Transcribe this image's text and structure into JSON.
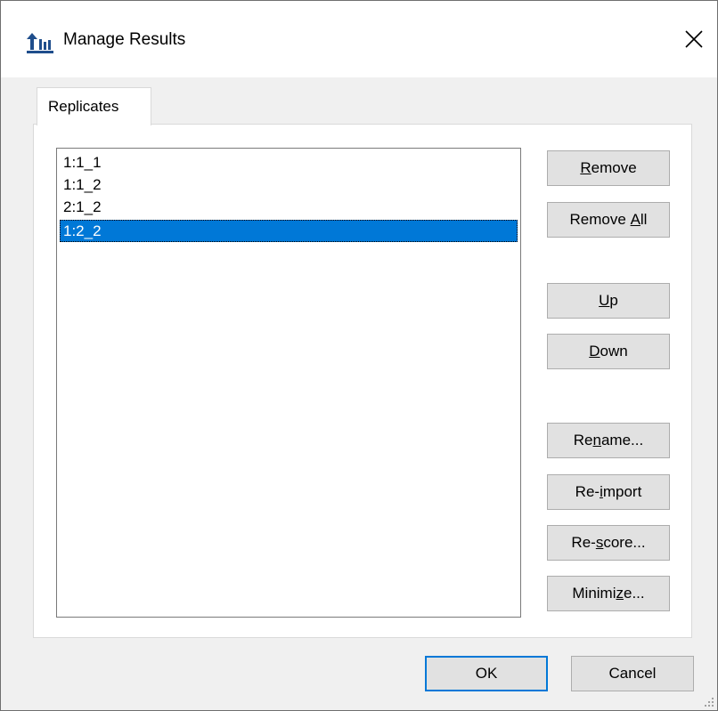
{
  "window": {
    "title": "Manage Results",
    "app_icon": "skyline-app-icon",
    "close_icon": "close-icon"
  },
  "tabs": [
    {
      "label": "Replicates",
      "active": true
    }
  ],
  "replicates": {
    "items": [
      {
        "label": "1:1_1",
        "selected": false
      },
      {
        "label": "1:1_2",
        "selected": false
      },
      {
        "label": "2:1_2",
        "selected": false
      },
      {
        "label": "1:2_2",
        "selected": true
      }
    ]
  },
  "buttons": {
    "remove": {
      "pre": "",
      "mnemonic": "R",
      "post": "emove"
    },
    "remove_all": {
      "pre": "Remove ",
      "mnemonic": "A",
      "post": "ll"
    },
    "up": {
      "pre": "",
      "mnemonic": "U",
      "post": "p"
    },
    "down": {
      "pre": "",
      "mnemonic": "D",
      "post": "own"
    },
    "rename": {
      "pre": "Re",
      "mnemonic": "n",
      "post": "ame..."
    },
    "reimport": {
      "pre": "Re-",
      "mnemonic": "i",
      "post": "mport"
    },
    "rescore": {
      "pre": "Re-",
      "mnemonic": "s",
      "post": "core..."
    },
    "minimize": {
      "pre": "Minimi",
      "mnemonic": "z",
      "post": "e..."
    },
    "ok": "OK",
    "cancel": "Cancel"
  },
  "colors": {
    "selection": "#0078d7",
    "button_face": "#e1e1e1",
    "dialog_bg": "#f0f0f0"
  }
}
